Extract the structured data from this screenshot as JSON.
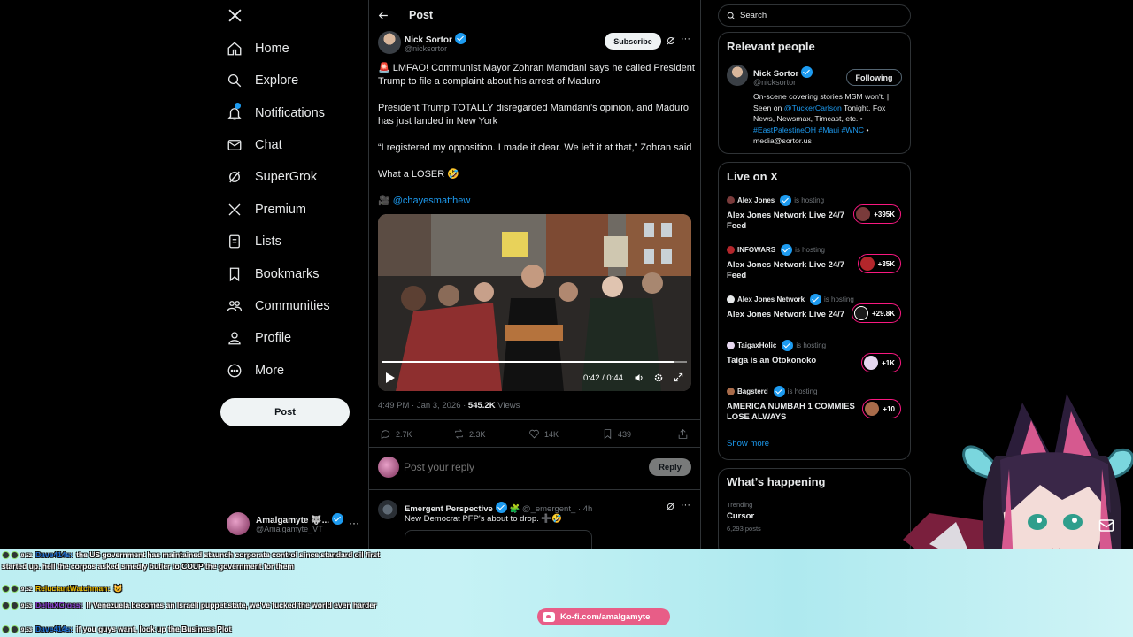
{
  "nav": {
    "items": [
      {
        "label": "Home",
        "icon": "home-icon"
      },
      {
        "label": "Explore",
        "icon": "search-icon"
      },
      {
        "label": "Notifications",
        "icon": "bell-icon"
      },
      {
        "label": "Chat",
        "icon": "mail-icon"
      },
      {
        "label": "SuperGrok",
        "icon": "grok-icon"
      },
      {
        "label": "Premium",
        "icon": "x-icon"
      },
      {
        "label": "Lists",
        "icon": "list-icon"
      },
      {
        "label": "Bookmarks",
        "icon": "bookmark-icon"
      },
      {
        "label": "Communities",
        "icon": "people-icon"
      },
      {
        "label": "Profile",
        "icon": "person-icon"
      },
      {
        "label": "More",
        "icon": "more-circle-icon"
      }
    ],
    "post_button": "Post",
    "account": {
      "name": "Amalgamyte 🐺...",
      "handle": "@Amalgamyte_VT"
    }
  },
  "header": {
    "title": "Post"
  },
  "tweet": {
    "author": "Nick Sortor",
    "handle": "@nicksortor",
    "subscribe": "Subscribe",
    "p1": "🚨 LMFAO! Communist Mayor Zohran Mamdani says he called President Trump to file a complaint about his arrest of Maduro",
    "p2": "President Trump TOTALLY disregarded Mamdani’s opinion, and Maduro has just landed in New York",
    "p3": "“I registered my opposition. I made it clear. We left it at that,” Zohran said",
    "p4": "What a LOSER 🤣",
    "credit_prefix": "🎥",
    "credit": "@chayesmatthew",
    "video_time": "0:42 / 0:44",
    "video_progress": 0.955,
    "meta_time": "4:49 PM · Jan 3, 2026 ·",
    "views_count": "545.2K",
    "views_label": "Views",
    "replies": "2.7K",
    "reposts": "2.3K",
    "likes": "14K",
    "bookmarks": "439"
  },
  "reply_box": {
    "placeholder": "Post your reply",
    "button": "Reply"
  },
  "reply": {
    "author": "Emergent Perspective",
    "badge": "🧩",
    "handle": "@_emergent_",
    "time": "· 4h",
    "text": "New Democrat PFP's about to drop. ➕🤣"
  },
  "search": {
    "placeholder": "Search"
  },
  "relevant": {
    "title": "Relevant people",
    "name": "Nick Sortor",
    "handle": "@nicksortor",
    "follow": "Following",
    "bio_1": "On-scene covering stories MSM won't. | Seen on",
    "bio_link_1": "@TuckerCarlson",
    "bio_2": "Tonight, Fox News, Newsmax, Timcast, etc. •",
    "bio_tags": "#EastPalestineOH #Maui #WNC",
    "bio_3": "•",
    "bio_4": "media@sortor.us"
  },
  "live": {
    "title": "Live on X",
    "hosting": "is hosting",
    "rows": [
      {
        "host": "Alex Jones",
        "title": "Alex Jones Network Live 24/7 Feed",
        "count": "+395K",
        "color": "#7a3b3b"
      },
      {
        "host": "INFOWARS",
        "title": "Alex Jones Network Live 24/7 Feed",
        "count": "+35K",
        "color": "#b3262b"
      },
      {
        "host": "Alex Jones Network",
        "title": "Alex Jones Network Live 24/7",
        "count": "+29.8K",
        "color": "#1a1a1a"
      },
      {
        "host": "TaigaxHolic",
        "title": "Taiga is an Otokonoko",
        "count": "+1K",
        "color": "#e6d7ef"
      },
      {
        "host": "Bagsterd",
        "title": "AMERICA NUMBAH 1 COMMIES LOSE ALWAYS",
        "count": "+10",
        "color": "#a86b4a"
      }
    ],
    "show_more": "Show more"
  },
  "happening": {
    "title": "What’s happening",
    "trending": "Trending",
    "topic": "Cursor",
    "posts": "6,293 posts"
  },
  "chat": {
    "lines": [
      {
        "time": "9:52",
        "user": "Dave414s:",
        "user_color": "#1d6fd6",
        "text": "the US government has maintained staunch corporate control since standard oil first started up. hell the corpos asked smedly butler to COUP the government for them"
      },
      {
        "time": "9:52",
        "user": "ReluctantWatchman:",
        "user_color": "#e6b800",
        "text": "😺"
      },
      {
        "time": "9:53",
        "user": "DeltaXCross:",
        "user_color": "#8a3fd6",
        "text": "If Venezuela becomes an Israeli puppet state, we've fucked the world even harder"
      },
      {
        "time": "9:53",
        "user": "Dave414s:",
        "user_color": "#1d6fd6",
        "text": "if you guys want, look up the Business Plot"
      }
    ]
  },
  "kofi": {
    "label": "Ko-fi.com/amalgamyte"
  }
}
